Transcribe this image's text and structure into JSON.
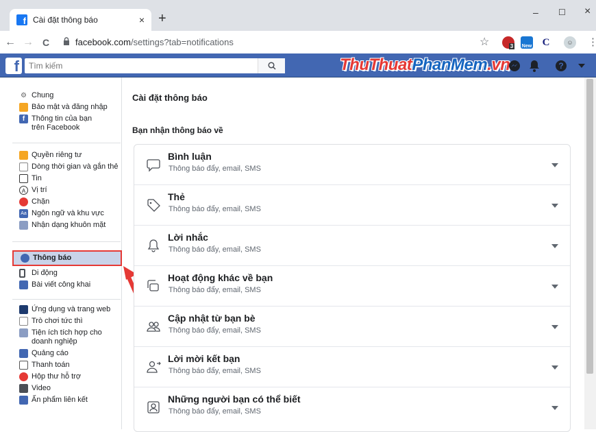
{
  "browser": {
    "tab_title": "Cài đặt thông báo",
    "tab_close": "×",
    "new_tab": "+",
    "url_host": "facebook.com",
    "url_path": "/settings?tab=notifications",
    "back": "←",
    "forward": "→",
    "reload": "C",
    "lock": "🔒",
    "star": "☆",
    "menu": "⋮",
    "minimize": "–",
    "maximize": "☐",
    "close": "×",
    "ext_abp": "3",
    "ext_new": "New",
    "ext_c": "C"
  },
  "fb": {
    "logo": "f",
    "search_placeholder": "Tìm kiếm",
    "search_icon": "🔍",
    "watermark_a": "ThuThuat",
    "watermark_b": "PhanMem",
    "watermark_c": ".vn"
  },
  "sidebar": {
    "group1": [
      {
        "label": "Chung",
        "icon": "gear-icon"
      },
      {
        "label": "Bảo mật và đăng nhập",
        "icon": "shield-icon"
      },
      {
        "label": "Thông tin của bạn trên Facebook",
        "icon": "facebook-icon"
      }
    ],
    "group2": [
      {
        "label": "Quyền riêng tư",
        "icon": "lock-icon"
      },
      {
        "label": "Dòng thời gian và gắn thẻ",
        "icon": "timeline-icon"
      },
      {
        "label": "Tin",
        "icon": "book-icon"
      },
      {
        "label": "Vị trí",
        "icon": "location-icon"
      },
      {
        "label": "Chặn",
        "icon": "block-icon"
      },
      {
        "label": "Ngôn ngữ và khu vực",
        "icon": "language-icon"
      },
      {
        "label": "Nhận dạng khuôn mặt",
        "icon": "face-icon"
      }
    ],
    "group3": [
      {
        "label": "Thông báo",
        "icon": "globe-icon"
      },
      {
        "label": "Di động",
        "icon": "mobile-icon"
      },
      {
        "label": "Bài viết công khai",
        "icon": "rss-icon"
      }
    ],
    "group4": [
      {
        "label": "Ứng dụng và trang web",
        "icon": "apps-icon"
      },
      {
        "label": "Trò chơi tức thì",
        "icon": "gamepad-icon"
      },
      {
        "label": "Tiện ích tích hợp cho doanh nghiệp",
        "icon": "business-icon"
      },
      {
        "label": "Quảng cáo",
        "icon": "ads-icon"
      },
      {
        "label": "Thanh toán",
        "icon": "card-icon"
      },
      {
        "label": "Hộp thư hỗ trợ",
        "icon": "support-icon"
      },
      {
        "label": "Video",
        "icon": "video-icon"
      },
      {
        "label": "Ấn phẩm liên kết",
        "icon": "publication-icon"
      }
    ]
  },
  "main": {
    "title": "Cài đặt thông báo",
    "subtitle": "Bạn nhận thông báo về",
    "rows": [
      {
        "title": "Bình luận",
        "desc": "Thông báo đẩy, email, SMS",
        "icon": "comment-icon"
      },
      {
        "title": "Thẻ",
        "desc": "Thông báo đẩy, email, SMS",
        "icon": "tag-icon"
      },
      {
        "title": "Lời nhắc",
        "desc": "Thông báo đẩy, email, SMS",
        "icon": "bell-icon"
      },
      {
        "title": "Hoạt động khác về bạn",
        "desc": "Thông báo đẩy, email, SMS",
        "icon": "activity-icon"
      },
      {
        "title": "Cập nhật từ bạn bè",
        "desc": "Thông báo đẩy, email, SMS",
        "icon": "friends-icon"
      },
      {
        "title": "Lời mời kết bạn",
        "desc": "Thông báo đẩy, email, SMS",
        "icon": "add-friend-icon"
      },
      {
        "title": "Những người bạn có thể biết",
        "desc": "Thông báo đẩy, email, SMS",
        "icon": "contact-icon"
      }
    ]
  },
  "colors": {
    "fb_blue": "#4267b2",
    "highlight_red": "#e53935",
    "active_bg": "#c9d3e9"
  }
}
